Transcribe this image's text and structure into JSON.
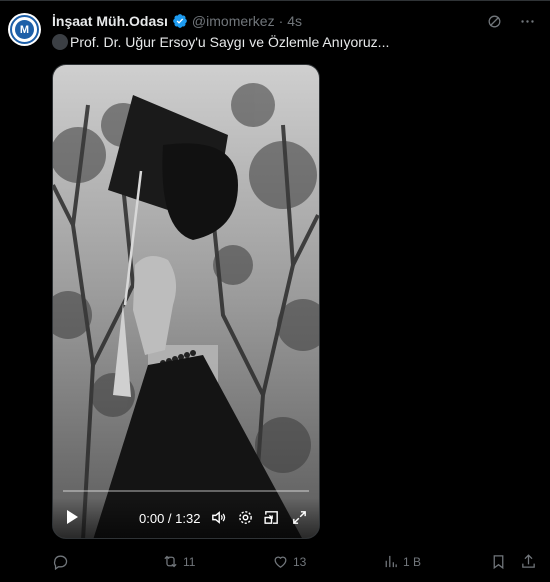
{
  "post": {
    "author_name": "İnşaat Müh.Odası",
    "handle": "@imomerkez",
    "separator": "·",
    "time": "4s",
    "text": "Prof. Dr. Uğur Ersoy'u Saygı ve Özlemle Anıyoruz...",
    "avatar_icon": "imo-logo-icon",
    "verified_icon": "verified-badge-icon",
    "verified_color": "#1d9bf0"
  },
  "video": {
    "timecode": "0:00 / 1:32",
    "progress": 0,
    "controls": [
      "play-icon",
      "volume-icon",
      "settings-icon",
      "pip-icon",
      "fullscreen-icon"
    ]
  },
  "actions": {
    "reply_count": "",
    "retweet_count": "11",
    "like_count": "13",
    "views_count": "1 B"
  },
  "colors": {
    "background": "#000000",
    "text_primary": "#e7e9ea",
    "text_secondary": "#71767b",
    "accent": "#1d9bf0"
  }
}
